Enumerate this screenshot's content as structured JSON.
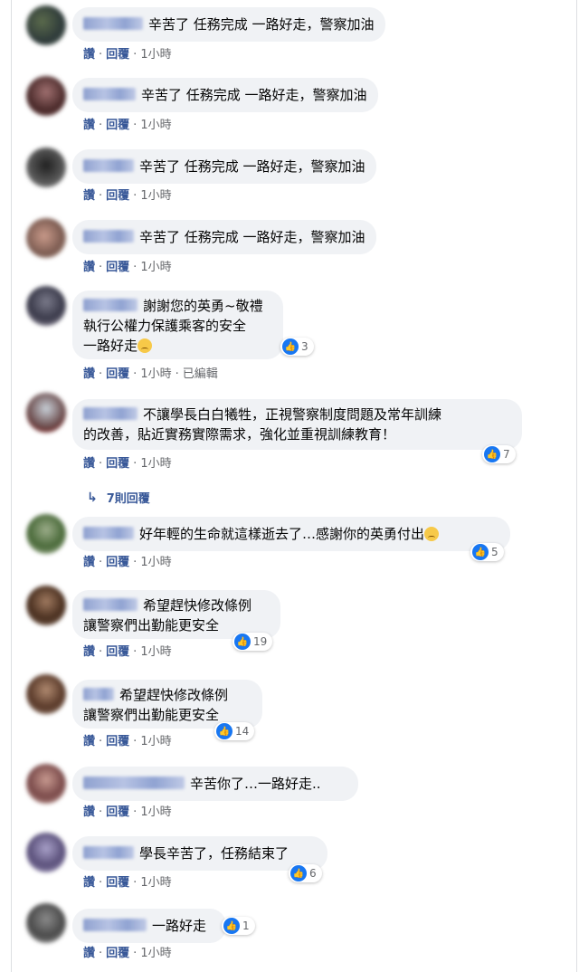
{
  "labels": {
    "like": "讚",
    "reply": "回覆",
    "edited": "已編輯"
  },
  "replies_link": "7則回覆",
  "comments": [
    {
      "text": "辛苦了 任務完成 一路好走，警察加油",
      "time": "1小時"
    },
    {
      "text": "辛苦了 任務完成 一路好走，警察加油",
      "time": "1小時"
    },
    {
      "text": "辛苦了 任務完成 一路好走，警察加油",
      "time": "1小時"
    },
    {
      "text": "辛苦了 任務完成 一路好走，警察加油",
      "time": "1小時"
    },
    {
      "text": "謝謝您的英勇~敬禮\n執行公權力保護乘客的安全\n一路好走",
      "reactions": "3",
      "time": "1小時",
      "edited": true
    },
    {
      "text": "不讓學長白白犧牲，正視警察制度問題及常年訓練\n的改善，貼近實務實際需求，強化並重視訓練教育！",
      "reactions": "7",
      "time": "1小時"
    },
    {
      "text": "好年輕的生命就這樣逝去了…感謝你的英勇付出",
      "reactions": "5",
      "time": "1小時"
    },
    {
      "text": "希望趕快修改條例\n讓警察們出勤能更安全",
      "reactions": "19",
      "time": "1小時"
    },
    {
      "text": "希望趕快修改條例\n讓警察們出勤能更安全",
      "reactions": "14",
      "time": "1小時"
    },
    {
      "text": "辛苦你了…一路好走..",
      "time": "1小時"
    },
    {
      "text": "學長辛苦了，任務結束了",
      "reactions": "6",
      "time": "1小時"
    },
    {
      "text": "一路好走",
      "reactions": "1",
      "time": "1小時"
    }
  ],
  "colors": {
    "link": "#385898",
    "bubble": "#f0f2f5",
    "like": "#1877f2"
  }
}
